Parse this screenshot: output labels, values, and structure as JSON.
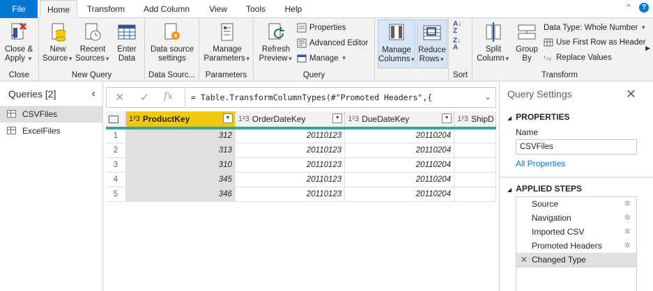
{
  "tabs": [
    {
      "label": "File"
    },
    {
      "label": "Home"
    },
    {
      "label": "Transform"
    },
    {
      "label": "Add Column"
    },
    {
      "label": "View"
    },
    {
      "label": "Tools"
    },
    {
      "label": "Help"
    }
  ],
  "ribbon": {
    "close_group": {
      "label": "Close",
      "close_apply_1": "Close &",
      "close_apply_2": "Apply"
    },
    "new_query_group": {
      "label": "New Query",
      "new_source_1": "New",
      "new_source_2": "Source",
      "recent_1": "Recent",
      "recent_2": "Sources",
      "enter_1": "Enter",
      "enter_2": "Data"
    },
    "data_sources_group": {
      "label": "Data Sourc...",
      "settings_1": "Data source",
      "settings_2": "settings"
    },
    "parameters_group": {
      "label": "Parameters",
      "manage_1": "Manage",
      "manage_2": "Parameters"
    },
    "query_group": {
      "label": "Query",
      "refresh_1": "Refresh",
      "refresh_2": "Preview",
      "properties": "Properties",
      "advanced_editor": "Advanced Editor",
      "manage": "Manage"
    },
    "columns_group": {
      "manage_cols_1": "Manage",
      "manage_cols_2": "Columns",
      "reduce_1": "Reduce",
      "reduce_2": "Rows"
    },
    "sort_group": {
      "label": "Sort"
    },
    "transform_group": {
      "label": "Transform",
      "split_1": "Split",
      "split_2": "Column",
      "group_1": "Group",
      "group_2": "By",
      "data_type": "Data Type: Whole Number",
      "first_row": "Use First Row as Header",
      "replace": "Replace Values"
    }
  },
  "queries": {
    "header": "Queries [2]",
    "items": [
      {
        "label": "CSVFiles",
        "selected": true
      },
      {
        "label": "ExcelFiles",
        "selected": false
      }
    ]
  },
  "formula": {
    "text": "= Table.TransformColumnTypes(#\"Promoted Headers\",{"
  },
  "table": {
    "type_label": "1²3",
    "columns": [
      "ProductKey",
      "OrderDateKey",
      "DueDateKey",
      "ShipD"
    ],
    "rows": [
      {
        "n": "1",
        "cells": [
          "312",
          "20110123",
          "20110204",
          ""
        ]
      },
      {
        "n": "2",
        "cells": [
          "313",
          "20110123",
          "20110204",
          ""
        ]
      },
      {
        "n": "3",
        "cells": [
          "310",
          "20110123",
          "20110204",
          ""
        ]
      },
      {
        "n": "4",
        "cells": [
          "345",
          "20110123",
          "20110204",
          ""
        ]
      },
      {
        "n": "5",
        "cells": [
          "346",
          "20110123",
          "20110204",
          ""
        ]
      }
    ]
  },
  "settings": {
    "title": "Query Settings",
    "properties_label": "PROPERTIES",
    "name_label": "Name",
    "name_value": "CSVFiles",
    "all_properties": "All Properties",
    "applied_steps_label": "APPLIED STEPS",
    "steps": [
      {
        "label": "Source",
        "gear": true
      },
      {
        "label": "Navigation",
        "gear": true
      },
      {
        "label": "Imported CSV",
        "gear": true
      },
      {
        "label": "Promoted Headers",
        "gear": true
      },
      {
        "label": "Changed Type",
        "gear": false
      }
    ]
  },
  "colors": {
    "accent": "#0078d4",
    "column_highlight": "#f2c811",
    "quality_bar": "#33a89a"
  }
}
